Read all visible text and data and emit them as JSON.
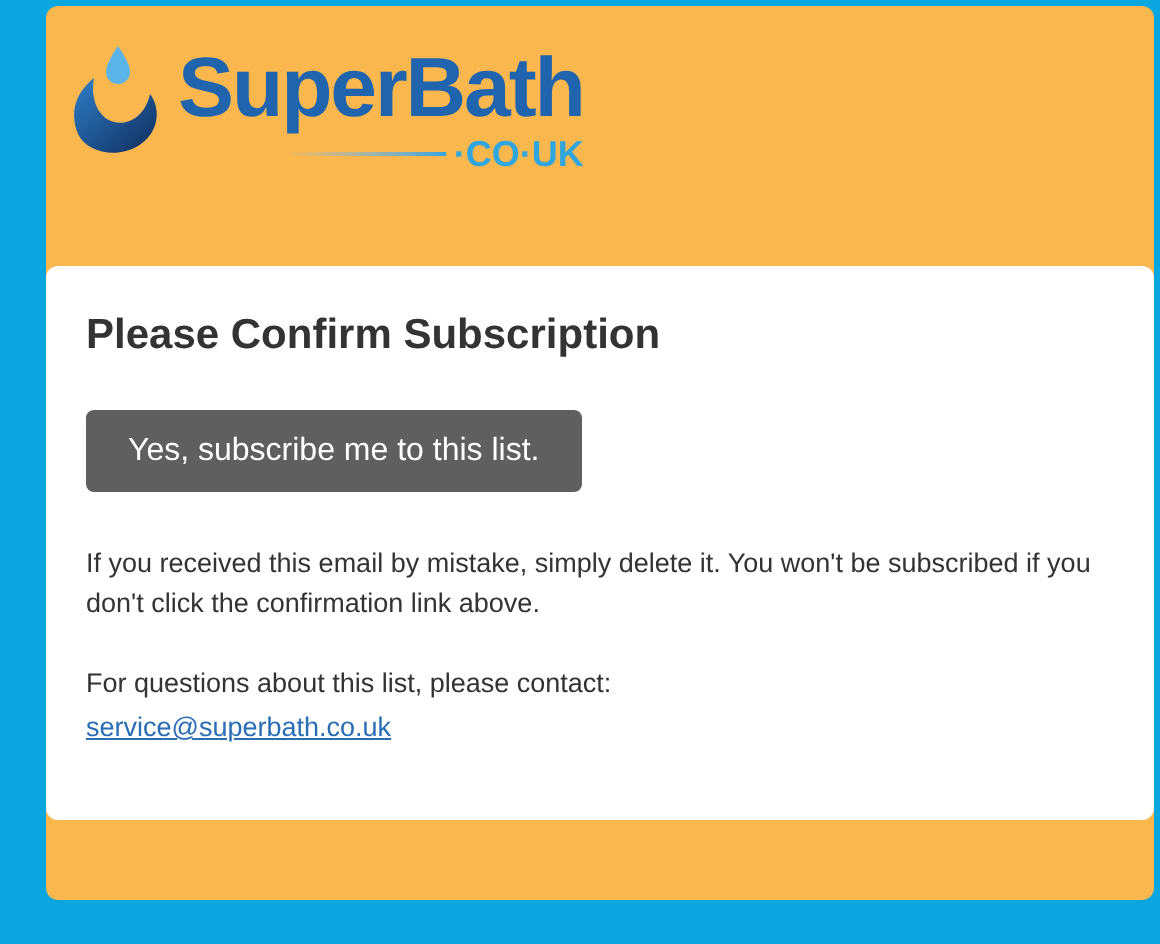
{
  "logo": {
    "name": "SuperBath",
    "domain": "·CO·UK"
  },
  "card": {
    "title": "Please Confirm Subscription",
    "button": "Yes, subscribe me to this list.",
    "notice": "If you received this email by mistake, simply delete it. You won't be subscribed if you don't click the confirmation link above.",
    "contact_text": "For questions about this list, please contact:",
    "contact_link": "service@superbath.co.uk"
  }
}
